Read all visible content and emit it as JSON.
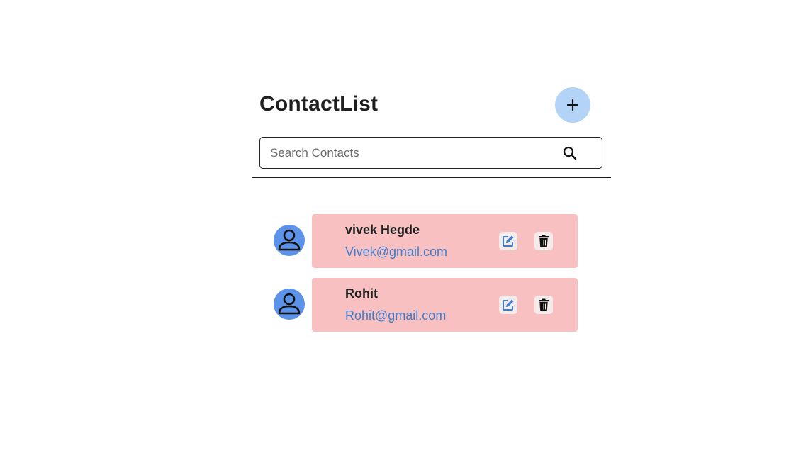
{
  "header": {
    "title": "ContactList",
    "add_button_icon": "plus-icon"
  },
  "search": {
    "placeholder": "Search Contacts",
    "value": "",
    "icon": "search-icon"
  },
  "contacts": [
    {
      "name": "vivek Hegde",
      "email": "Vivek@gmail.com"
    },
    {
      "name": "Rohit",
      "email": "Rohit@gmail.com"
    }
  ],
  "colors": {
    "add_button": "#b3d4f7",
    "avatar": "#5b93ea",
    "card": "#f8c0c0",
    "email": "#3d7fd0",
    "edit_icon": "#3d7fd0",
    "delete_icon": "#111111"
  }
}
